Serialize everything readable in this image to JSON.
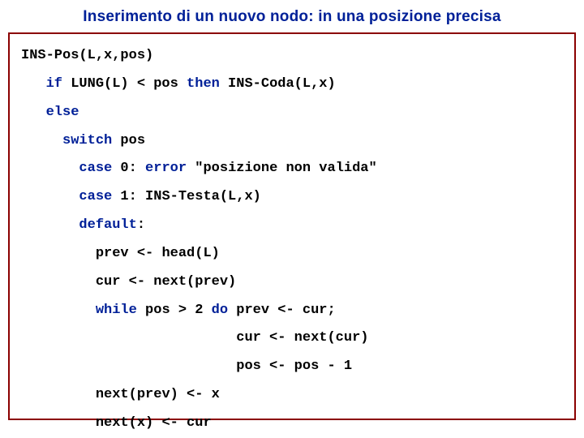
{
  "title": "Inserimento di un nuovo nodo: in una posizione precisa",
  "code": {
    "sig": "INS-Pos(L,x,pos)",
    "kw_if": "if",
    "cond_if": " LUNG(L) < pos ",
    "kw_then": "then",
    "call_coda": " INS-Coda(L,x)",
    "kw_else": "else",
    "kw_switch": "switch",
    "switch_expr": " pos",
    "kw_case0": "case",
    "case0_cond": " 0: ",
    "kw_error": "error",
    "case0_msg": " \"posizione non valida\"",
    "kw_case1": "case",
    "case1_body": " 1: INS-Testa(L,x)",
    "kw_default": "default",
    "default_colon": ":",
    "prev_head": "prev <- head(L)",
    "cur_next": "cur <- next(prev)",
    "kw_while": "while",
    "while_cond": " pos > 2 ",
    "kw_do": "do",
    "while_body1": " prev <- cur;",
    "while_body2": "cur <- next(cur)",
    "while_body3": "pos <- pos - 1",
    "assign_next_prev": "next(prev) <- x",
    "assign_next_x": "next(x) <- cur"
  }
}
